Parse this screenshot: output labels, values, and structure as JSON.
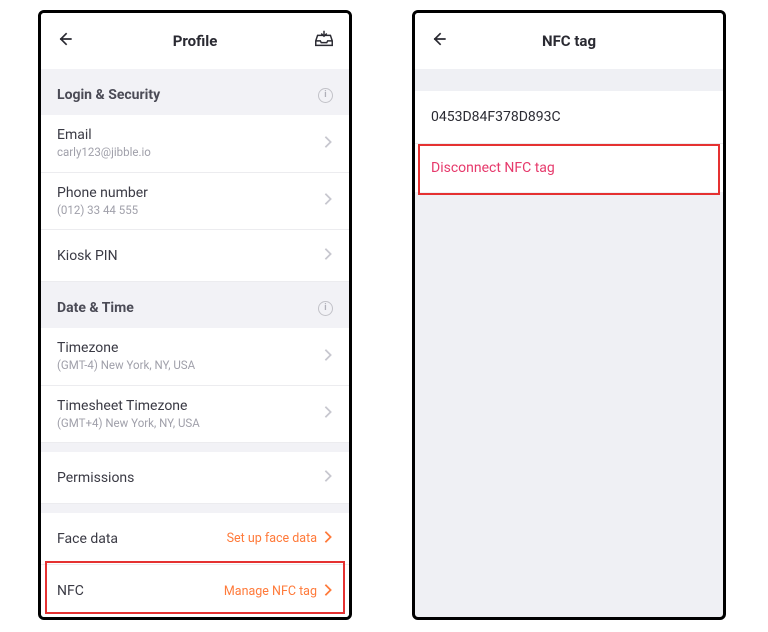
{
  "left": {
    "title": "Profile",
    "sections": {
      "login": {
        "header": "Login & Security",
        "email": {
          "label": "Email",
          "value": "carly123@jibble.io"
        },
        "phone": {
          "label": "Phone number",
          "value": "(012) 33 44 555"
        },
        "kiosk": {
          "label": "Kiosk PIN"
        }
      },
      "date": {
        "header": "Date & Time",
        "timezone": {
          "label": "Timezone",
          "value": "(GMT-4) New York, NY, USA"
        },
        "timesheet": {
          "label": "Timesheet Timezone",
          "value": "(GMT+4) New York, NY, USA"
        }
      },
      "permissions": {
        "label": "Permissions"
      },
      "face": {
        "label": "Face data",
        "action": "Set up face data"
      },
      "nfc": {
        "label": "NFC",
        "action": "Manage NFC tag"
      }
    }
  },
  "right": {
    "title": "NFC tag",
    "tag_id": "0453D84F378D893C",
    "disconnect": "Disconnect NFC tag"
  }
}
